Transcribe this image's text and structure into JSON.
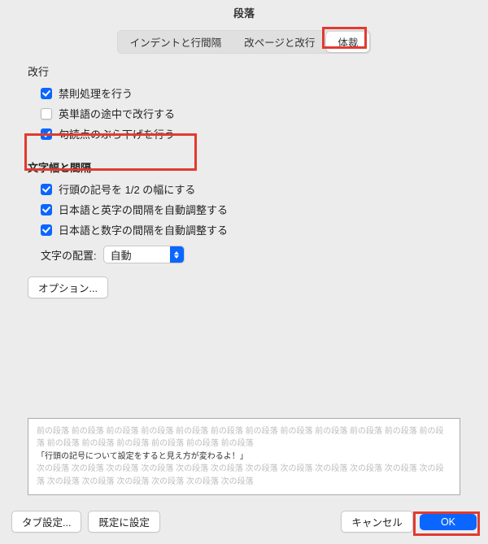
{
  "window": {
    "title": "段落"
  },
  "tabs": {
    "indent": "インデントと行間隔",
    "pagebreak": "改ページと改行",
    "typography": "体裁"
  },
  "section_linebreak": {
    "title": "改行",
    "forbidden": "禁則処理を行う",
    "english_words": "英単語の途中で改行する",
    "punctuation_hang": "句読点のぶら下げを行う"
  },
  "section_spacing": {
    "title": "文字幅と間隔",
    "halfwidth_first": "行頭の記号を 1/2 の幅にする",
    "jp_en_space": "日本語と英字の間隔を自動調整する",
    "jp_num_space": "日本語と数字の間隔を自動調整する",
    "alignment_label": "文字の配置:",
    "alignment_value": "自動"
  },
  "options_button": "オプション...",
  "preview": {
    "prev": "前の段落 前の段落 前の段落 前の段落 前の段落 前の段落 前の段落 前の段落 前の段落 前の段落 前の段落 前の段落 前の段落 前の段落 前の段落 前の段落 前の段落 前の段落",
    "current": "「行頭の記号について設定をすると見え方が変わるよ！」",
    "next": "次の段落 次の段落 次の段落 次の段落 次の段落 次の段落 次の段落 次の段落 次の段落 次の段落 次の段落 次の段落 次の段落 次の段落 次の段落 次の段落 次の段落 次の段落"
  },
  "footer": {
    "tab_settings": "タブ設定...",
    "set_default": "既定に設定",
    "cancel": "キャンセル",
    "ok": "OK"
  },
  "highlight_color": "#e23a2f"
}
